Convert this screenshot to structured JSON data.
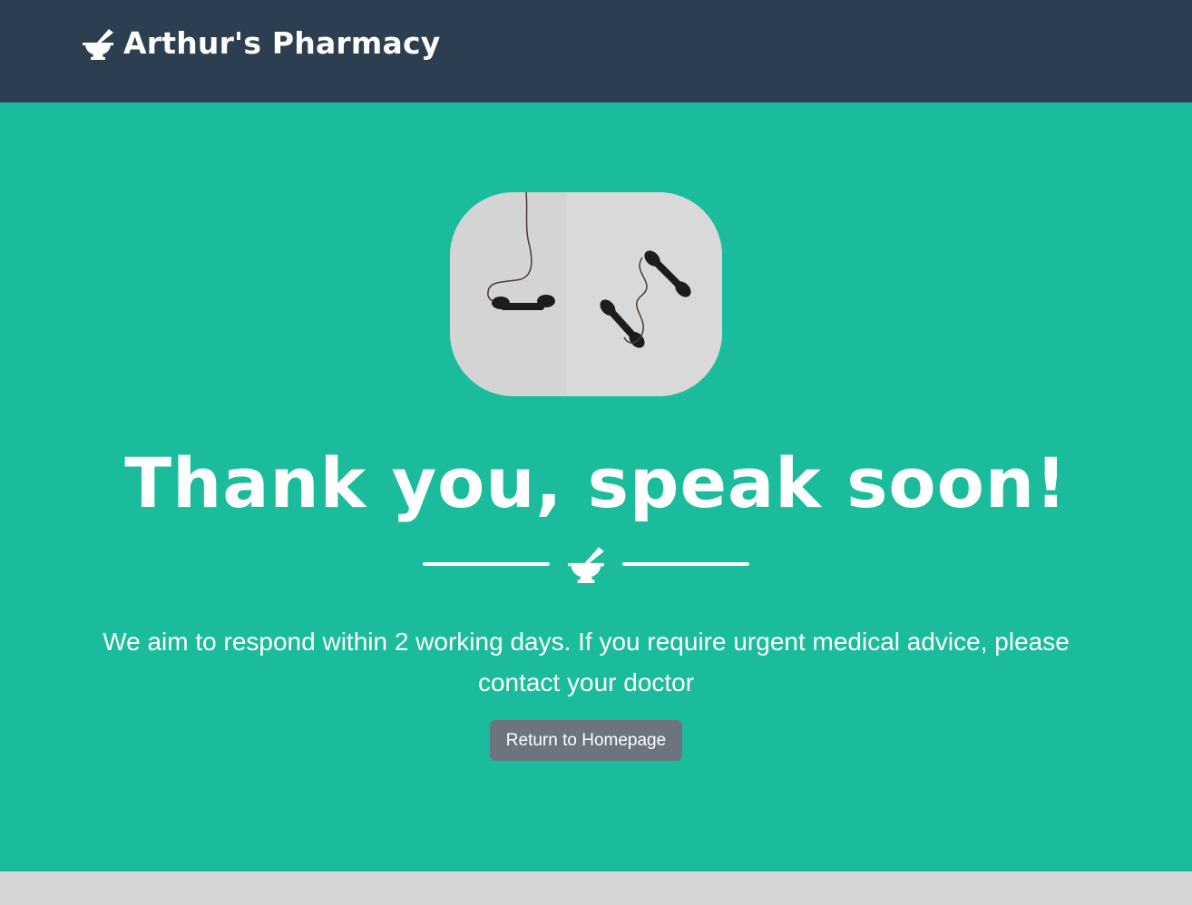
{
  "navbar": {
    "brand_name": "Arthur's Pharmacy",
    "brand_icon": "mortar-pestle-icon"
  },
  "masthead": {
    "image": "vintage-telephone-handsets-photo",
    "headline": "Thank you, speak soon!",
    "divider_icon": "mortar-pestle-icon",
    "lead": "We aim to respond within 2 working days. If you require urgent medical advice, please contact your doctor",
    "button_label": "Return to Homepage"
  },
  "colors": {
    "navbar": "#2c3e50",
    "masthead": "#1abc9c",
    "button": "#6c757d",
    "footer": "#d6d6d6"
  }
}
